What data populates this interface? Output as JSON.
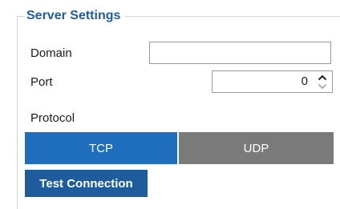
{
  "group": {
    "title": "Server Settings"
  },
  "fields": {
    "domain": {
      "label": "Domain",
      "value": ""
    },
    "port": {
      "label": "Port",
      "value": "0"
    },
    "protocol": {
      "label": "Protocol",
      "options": [
        "TCP",
        "UDP"
      ],
      "selected": "TCP"
    }
  },
  "actions": {
    "test_connection_label": "Test Connection"
  },
  "colors": {
    "title_blue": "#1f5c9e",
    "selected_blue": "#1f6ebd",
    "unselected_gray": "#7a7a7a"
  }
}
